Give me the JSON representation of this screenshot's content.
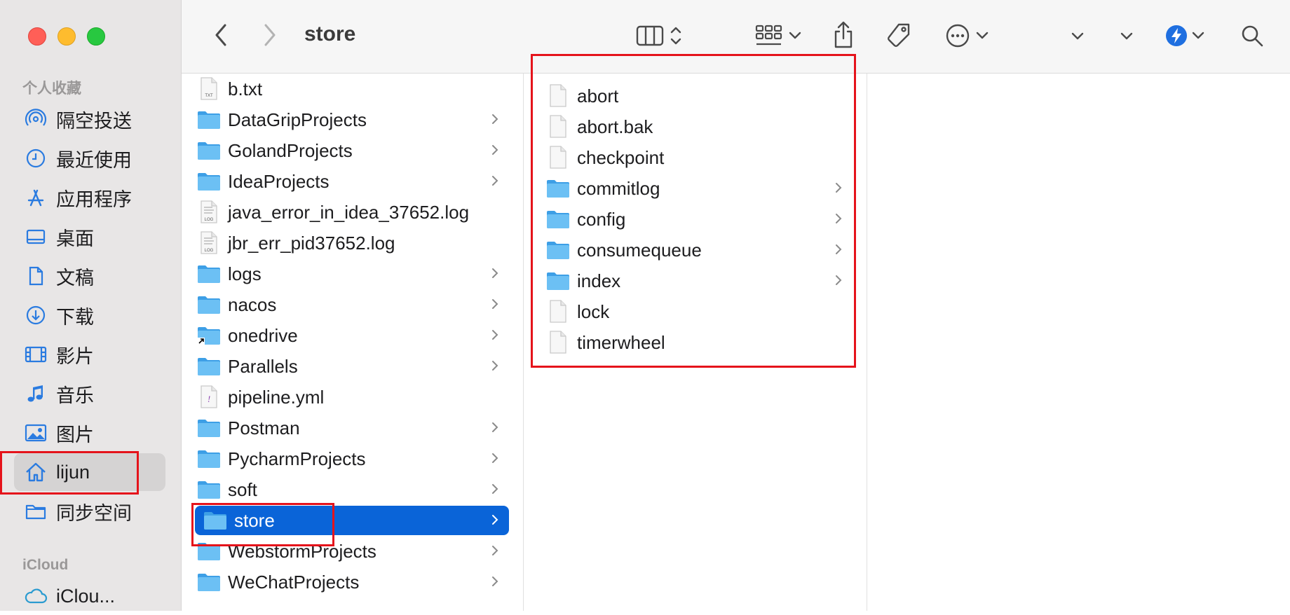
{
  "window": {
    "title": "store"
  },
  "sidebar": {
    "favorites_heading": "个人收藏",
    "items": [
      {
        "label": "隔空投送",
        "icon": "airdrop-icon"
      },
      {
        "label": "最近使用",
        "icon": "clock-icon"
      },
      {
        "label": "应用程序",
        "icon": "applications-icon"
      },
      {
        "label": "桌面",
        "icon": "desktop-icon"
      },
      {
        "label": "文稿",
        "icon": "document-icon"
      },
      {
        "label": "下载",
        "icon": "download-icon"
      },
      {
        "label": "影片",
        "icon": "film-icon"
      },
      {
        "label": "音乐",
        "icon": "music-icon"
      },
      {
        "label": "图片",
        "icon": "photo-icon"
      },
      {
        "label": "lijun",
        "icon": "home-icon",
        "selected": true
      },
      {
        "label": "同步空间",
        "icon": "folder-icon"
      }
    ],
    "icloud_heading": "iCloud",
    "icloud_items": [
      {
        "label": "iClou...",
        "icon": "icloud-icon"
      }
    ]
  },
  "column1": {
    "items": [
      {
        "name": "b.txt",
        "kind": "txt"
      },
      {
        "name": "DataGripProjects",
        "kind": "folder"
      },
      {
        "name": "GolandProjects",
        "kind": "folder"
      },
      {
        "name": "IdeaProjects",
        "kind": "folder"
      },
      {
        "name": "java_error_in_idea_37652.log",
        "kind": "log"
      },
      {
        "name": "jbr_err_pid37652.log",
        "kind": "log"
      },
      {
        "name": "logs",
        "kind": "folder"
      },
      {
        "name": "nacos",
        "kind": "folder"
      },
      {
        "name": "onedrive",
        "kind": "alias-folder"
      },
      {
        "name": "Parallels",
        "kind": "folder"
      },
      {
        "name": "pipeline.yml",
        "kind": "yml"
      },
      {
        "name": "Postman",
        "kind": "folder"
      },
      {
        "name": "PycharmProjects",
        "kind": "folder"
      },
      {
        "name": "soft",
        "kind": "folder"
      },
      {
        "name": "store",
        "kind": "folder",
        "selected": true
      },
      {
        "name": "WebstormProjects",
        "kind": "folder"
      },
      {
        "name": "WeChatProjects",
        "kind": "folder"
      }
    ]
  },
  "column2": {
    "items": [
      {
        "name": "abort",
        "kind": "file"
      },
      {
        "name": "abort.bak",
        "kind": "file"
      },
      {
        "name": "checkpoint",
        "kind": "file"
      },
      {
        "name": "commitlog",
        "kind": "folder"
      },
      {
        "name": "config",
        "kind": "folder"
      },
      {
        "name": "consumequeue",
        "kind": "folder"
      },
      {
        "name": "index",
        "kind": "folder"
      },
      {
        "name": "lock",
        "kind": "file"
      },
      {
        "name": "timerwheel",
        "kind": "file"
      }
    ]
  },
  "colors": {
    "selection": "#0a64d8",
    "folder": "#5cb3ee",
    "annotation": "#e5131b",
    "sidebar_bg": "#e8e6e6"
  }
}
